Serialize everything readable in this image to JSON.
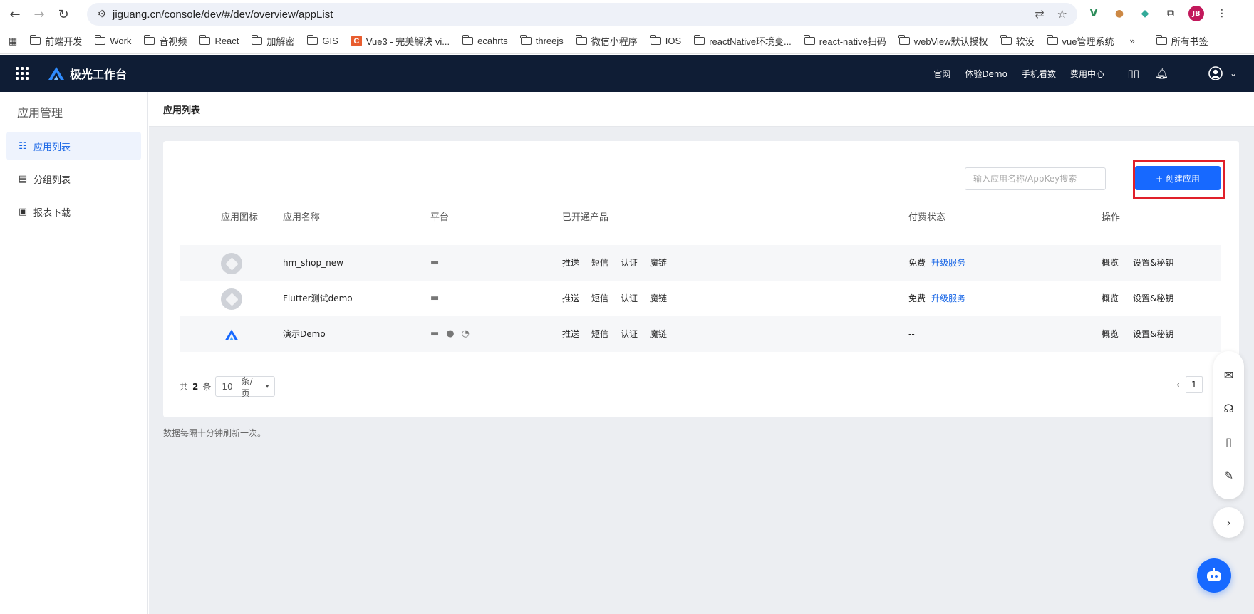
{
  "browser": {
    "url": "jiguang.cn/console/dev/#/dev/overview/appList",
    "avatar_initials": "JB",
    "bookmarks": [
      "前端开发",
      "Work",
      "音视频",
      "React",
      "加解密",
      "GIS",
      "Vue3 - 完美解决 vi...",
      "ecahrts",
      "threejs",
      "微信小程序",
      "IOS",
      "reactNative环境变...",
      "react-native扫码",
      "webView默认授权",
      "软设",
      "vue管理系统"
    ],
    "more_bookmarks": "»",
    "all_bookmarks": "所有书签"
  },
  "header": {
    "brand": "极光工作台",
    "links": [
      "官网",
      "体验Demo",
      "手机看数",
      "费用中心"
    ]
  },
  "sidebar": {
    "title": "应用管理",
    "items": [
      {
        "label": "应用列表",
        "active": true,
        "icon": "list-icon"
      },
      {
        "label": "分组列表",
        "active": false,
        "icon": "table-icon"
      },
      {
        "label": "报表下载",
        "active": false,
        "icon": "report-icon"
      }
    ]
  },
  "page": {
    "breadcrumb": "应用列表",
    "search_placeholder": "输入应用名称/AppKey搜索",
    "create_button": "+ 创建应用",
    "columns": [
      "应用图标",
      "应用名称",
      "平台",
      "已开通产品",
      "付费状态",
      "操作"
    ],
    "rows": [
      {
        "name": "hm_shop_new",
        "platforms": [
          "android-icon"
        ],
        "products": [
          "推送",
          "短信",
          "认证",
          "魔链"
        ],
        "pay": "免费",
        "upgrade": "升级服务",
        "ops": [
          "概览",
          "设置&秘钥"
        ]
      },
      {
        "name": "Flutter测试demo",
        "platforms": [
          "android-icon"
        ],
        "products": [
          "推送",
          "短信",
          "认证",
          "魔链"
        ],
        "pay": "免费",
        "upgrade": "升级服务",
        "ops": [
          "概览",
          "设置&秘钥"
        ]
      },
      {
        "name": "演示Demo",
        "platforms": [
          "android-icon",
          "apple-icon",
          "harmony-icon"
        ],
        "products": [
          "推送",
          "短信",
          "认证",
          "魔链"
        ],
        "pay": "--",
        "upgrade": "",
        "ops": [
          "概览",
          "设置&秘钥"
        ]
      }
    ],
    "pager": {
      "total_prefix": "共",
      "total": "2",
      "total_suffix": "条",
      "page_size": "10",
      "page_size_unit": "条/页",
      "current_page": "1"
    },
    "note": "数据每隔十分钟刷新一次。"
  },
  "colors": {
    "primary": "#1769ff",
    "header_bg": "#0f1d35",
    "highlight_border": "#e0202a"
  }
}
